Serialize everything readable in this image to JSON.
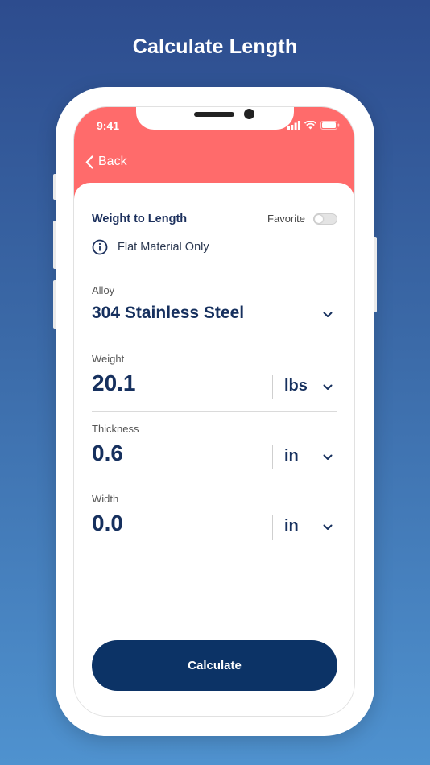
{
  "headline": "Calculate Length",
  "status_bar": {
    "time": "9:41"
  },
  "nav": {
    "back_label": "Back"
  },
  "card": {
    "title": "Weight to Length",
    "favorite_label": "Favorite",
    "favorite_on": false,
    "info_text": "Flat Material Only"
  },
  "fields": {
    "alloy": {
      "label": "Alloy",
      "value": "304 Stainless Steel"
    },
    "weight": {
      "label": "Weight",
      "value": "20.1",
      "unit": "lbs"
    },
    "thickness": {
      "label": "Thickness",
      "value": "0.6",
      "unit": "in"
    },
    "width": {
      "label": "Width",
      "value": "0.0",
      "unit": "in"
    }
  },
  "calculate_label": "Calculate",
  "colors": {
    "header_bg": "#ff6b6b",
    "primary": "#0c3366",
    "text_dark": "#16305e"
  }
}
